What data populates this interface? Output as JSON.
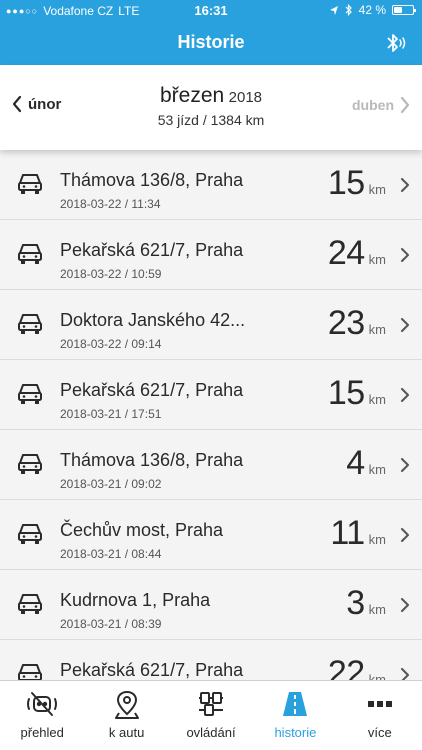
{
  "status_bar": {
    "carrier": "Vodafone CZ",
    "network": "LTE",
    "time": "16:31",
    "battery": "42 %",
    "battery_level": 0.42
  },
  "header": {
    "title": "Historie",
    "bluetooth_icon": "bluetooth-icon"
  },
  "month_nav": {
    "prev_label": "únor",
    "next_label": "duben",
    "month": "březen",
    "year": "2018",
    "summary": "53 jízd / 1384 km"
  },
  "trips": [
    {
      "address": "Thámova 136/8, Praha",
      "datetime": "2018-03-22 / 11:34",
      "distance": "15",
      "unit": "km"
    },
    {
      "address": "Pekařská 621/7, Praha",
      "datetime": "2018-03-22 / 10:59",
      "distance": "24",
      "unit": "km"
    },
    {
      "address": "Doktora Janského 42...",
      "datetime": "2018-03-22 / 09:14",
      "distance": "23",
      "unit": "km"
    },
    {
      "address": "Pekařská 621/7, Praha",
      "datetime": "2018-03-21 / 17:51",
      "distance": "15",
      "unit": "km"
    },
    {
      "address": "Thámova 136/8, Praha",
      "datetime": "2018-03-21 / 09:02",
      "distance": "4",
      "unit": "km"
    },
    {
      "address": "Čechův most, Praha",
      "datetime": "2018-03-21 / 08:44",
      "distance": "11",
      "unit": "km"
    },
    {
      "address": "Kudrnova 1, Praha",
      "datetime": "2018-03-21 / 08:39",
      "distance": "3",
      "unit": "km"
    },
    {
      "address": "Pekařská 621/7, Praha",
      "datetime": "",
      "distance": "22",
      "unit": "km"
    }
  ],
  "tabs": [
    {
      "label": "přehled",
      "icon": "overview-icon"
    },
    {
      "label": "k autu",
      "icon": "map-pin-icon"
    },
    {
      "label": "ovládání",
      "icon": "controls-icon"
    },
    {
      "label": "historie",
      "icon": "road-icon"
    },
    {
      "label": "více",
      "icon": "more-icon"
    }
  ],
  "colors": {
    "accent": "#2aa1df",
    "list_bg": "#f4f4f4",
    "disabled": "#b9b9b9"
  }
}
